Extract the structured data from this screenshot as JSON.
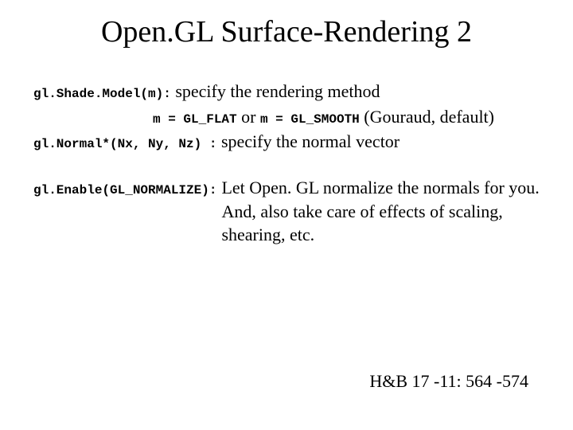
{
  "title": "Open.GL Surface-Rendering 2",
  "line1": {
    "code": "gl.Shade.Model(m):",
    "text": " specify the rendering method"
  },
  "line2": {
    "code1": "m = GL_FLAT",
    "mid": " or ",
    "code2": "m = GL_SMOOTH",
    "tail": " (Gouraud, default)"
  },
  "line3": {
    "code": "gl.Normal*(Nx, Ny, Nz) :",
    "text": " specify the normal vector"
  },
  "block2": {
    "code": "gl.Enable(GL_NORMALIZE):",
    "text": " Let Open. GL normalize the normals for you. And, also take care of effects of scaling, shearing, etc."
  },
  "footer": "H&B 17 -11: 564 -574"
}
